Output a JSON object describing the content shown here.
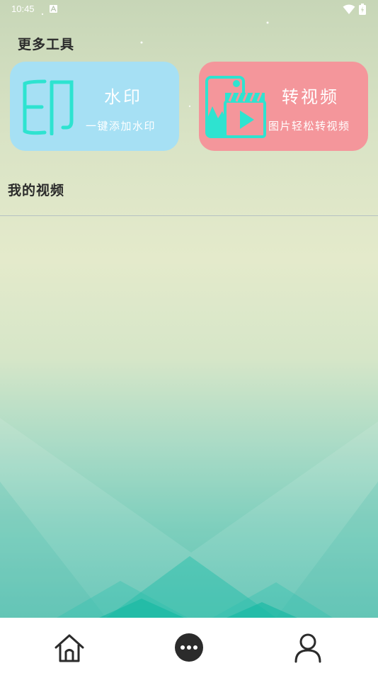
{
  "status_bar": {
    "time": "10:45",
    "notification_icon": "notification-a-icon",
    "wifi_icon": "wifi-icon",
    "battery_icon": "battery-icon"
  },
  "tools_section": {
    "title": "更多工具",
    "cards": [
      {
        "icon": "watermark-stamp-icon",
        "title": "水印",
        "subtitle": "一键添加水印",
        "color": "#a6e0f4"
      },
      {
        "icon": "image-to-video-icon",
        "title": "转视频",
        "subtitle": "图片轻松转视频",
        "color": "#f4969b"
      }
    ]
  },
  "videos_section": {
    "title": "我的视频"
  },
  "bottom_nav": {
    "items": [
      {
        "icon": "home-icon"
      },
      {
        "icon": "more-dots-icon"
      },
      {
        "icon": "profile-icon"
      }
    ]
  },
  "colors": {
    "accent_teal": "#2ee3d0",
    "nav_icon": "#2b2b2b"
  }
}
